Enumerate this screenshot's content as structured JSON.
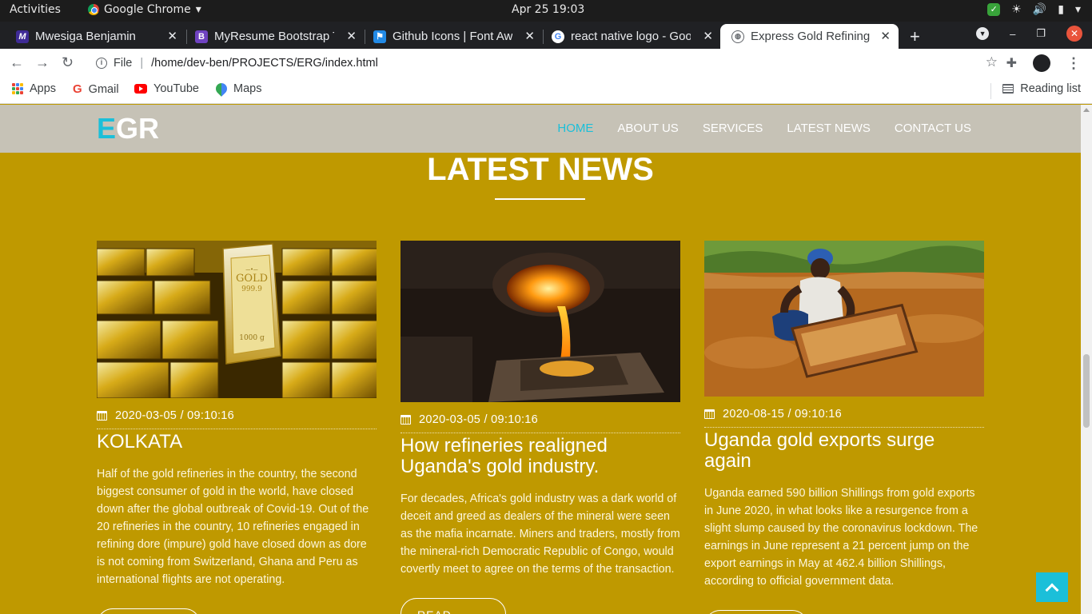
{
  "system_bar": {
    "activities": "Activities",
    "app_name": "Google Chrome",
    "clock": "Apr 25  19:03"
  },
  "tabs": [
    {
      "label": "Mwesiga Benjamin",
      "icon": "mwesiga-favicon",
      "color": "#3f2b96"
    },
    {
      "label": "MyResume Bootstrap T",
      "icon": "bootstrap-favicon",
      "color": "#6f42c1"
    },
    {
      "label": "Github Icons | Font Awe",
      "icon": "font-awesome-favicon",
      "color": "#228ae6"
    },
    {
      "label": "react native logo - Goog",
      "icon": "google-favicon",
      "color": "#ffffff"
    },
    {
      "label": "Express Gold Refining L",
      "icon": "globe-favicon",
      "color": "#5f6368",
      "active": true
    }
  ],
  "omnibox": {
    "scheme": "File",
    "url": "/home/dev-ben/PROJECTS/ERG/index.html"
  },
  "bookmarks": [
    {
      "label": "Apps",
      "icon": "apps-grid-icon"
    },
    {
      "label": "Gmail",
      "icon": "gmail-icon"
    },
    {
      "label": "YouTube",
      "icon": "youtube-icon"
    },
    {
      "label": "Maps",
      "icon": "maps-icon"
    }
  ],
  "reading_list": "Reading list",
  "site": {
    "logo_accent": "E",
    "logo_rest": "GR",
    "accent_color": "#1bbfd9",
    "nav": [
      "HOME",
      "ABOUT US",
      "SERVICES",
      "LATEST NEWS",
      "CONTACT US"
    ],
    "nav_active": "HOME",
    "section_title": "LATEST NEWS",
    "read_more": "READ MORE"
  },
  "news": [
    {
      "image": "gold-bars",
      "date": "2020-03-05 / 09:10:16",
      "title": "KOLKATA",
      "body": "Half of the gold refineries in the country, the second biggest consumer of gold in the world, have closed down after the global outbreak of Covid-19. Out of the 20 refineries in the country, 10 refineries engaged in refining dore (impure) gold have closed down as dore is not coming from Switzerland, Ghana and Peru as international flights are not operating.",
      "bar_stamp": "GOLD",
      "bar_purity": "999.9",
      "bar_weight": "1000 g"
    },
    {
      "image": "molten-gold-pour",
      "date": "2020-03-05 / 09:10:16",
      "title": "How refineries realigned Uganda's gold industry.",
      "body": "For decades, Africa's gold industry was a dark world of deceit and greed as dealers of the mineral were seen as the mafia incarnate. Miners and traders, mostly from the mineral-rich Democratic Republic of Congo, would covertly meet to agree on the terms of the transaction."
    },
    {
      "image": "gold-miner-washing",
      "date": "2020-08-15 / 09:10:16",
      "title": "Uganda gold exports surge again",
      "body": "Uganda earned 590 billion Shillings from gold exports in June 2020, in what looks like a resurgence from a slight slump caused by the coronavirus lockdown. The earnings in June represent a 21 percent jump on the export earnings in May at 462.4 billion Shillings, according to official government data."
    }
  ]
}
